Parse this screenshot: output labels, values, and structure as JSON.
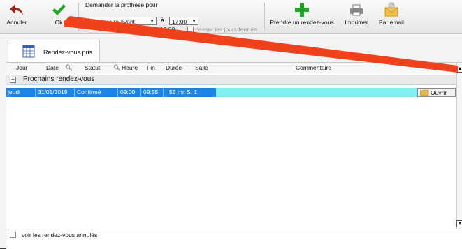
{
  "toolbar": {
    "annuler_label": "Annuler",
    "ok_label": "Ok",
    "prothese_title": "Demander la prothèse pour",
    "delay_value": "1 jour ouvré avant",
    "a_label": "à",
    "time_value": "17:00",
    "date_line": "le 30/01/2019 à 17:00",
    "skip_closed_label": "passer les jours fermés",
    "appointment_label": "Prendre un rendez-vous",
    "print_label": "Imprimer",
    "email_label": "Par email"
  },
  "tab": {
    "label": "Rendez-vous pris"
  },
  "columns": {
    "jour": "Jour",
    "date": "Date",
    "statut": "Statut",
    "heure": "Heure",
    "fin": "Fin",
    "duree": "Durée",
    "salle": "Salle",
    "commentaire": "Commentaire"
  },
  "group": {
    "title": "Prochains rendez-vous",
    "toggle": "−"
  },
  "rows": [
    {
      "jour": "jeudi",
      "date": "31/01/2019",
      "statut": "Confirmé",
      "heure": "09:00",
      "fin": "09:55",
      "duree": "55 mn",
      "salle": "S. 1",
      "action": "Ouvrir"
    }
  ],
  "footer": {
    "show_cancelled_label": "voir les rendez-vous annulés"
  },
  "colors": {
    "selected_row": "#1c86e8",
    "comment_cell": "#7ff0f4",
    "annotation_line": "#f0411d",
    "ok_check": "#22a32a",
    "annuler_arrow": "#9a2a1e"
  }
}
